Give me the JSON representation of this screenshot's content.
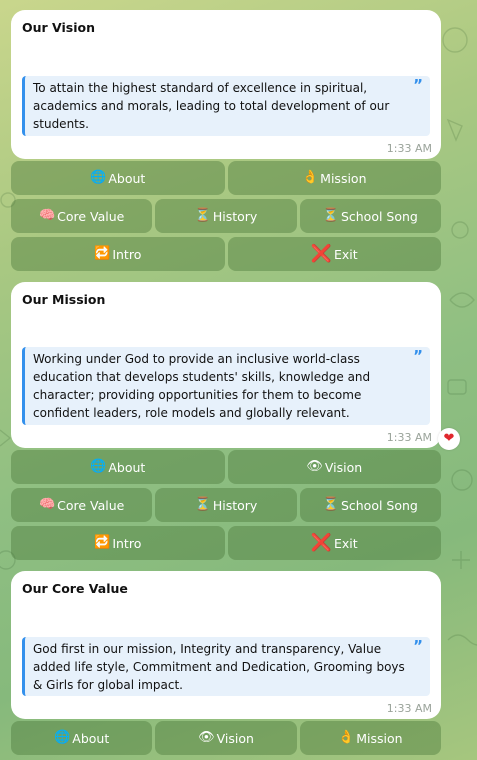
{
  "messages": [
    {
      "title": "Our Vision",
      "quote": "To attain the highest standard of excellence in spiritual, academics and morals, leading to total development of our students.",
      "time": "1:33 AM",
      "reaction": null
    },
    {
      "title": "Our Mission",
      "quote": "Working under God to provide an inclusive world-class education that develops students' skills, knowledge and character; providing opportunities for them to become confident leaders, role models and globally relevant.",
      "time": "1:33 AM",
      "reaction": "heart"
    },
    {
      "title": "Our Core Value",
      "quote": "God first in our mission, Integrity and transparency, Value added life style, Commitment and Dedication, Grooming boys & Girls for global impact.",
      "time": "1:33 AM",
      "reaction": null
    }
  ],
  "quote_mark": "”",
  "reaction_glyph": "❤",
  "keyboards": [
    [
      [
        {
          "icon": "🌐",
          "label": "About"
        },
        {
          "icon": "👌",
          "label": "Mission"
        }
      ],
      [
        {
          "icon": "🧠",
          "label": "Core Value"
        },
        {
          "icon": "⏳",
          "label": "History"
        },
        {
          "icon": "⏳",
          "label": "School Song"
        }
      ],
      [
        {
          "icon": "🔁",
          "label": "Intro"
        },
        {
          "icon": "❌",
          "label": "Exit"
        }
      ]
    ],
    [
      [
        {
          "icon": "🌐",
          "label": "About"
        },
        {
          "icon": "👁",
          "label": "Vision"
        }
      ],
      [
        {
          "icon": "🧠",
          "label": "Core Value"
        },
        {
          "icon": "⏳",
          "label": "History"
        },
        {
          "icon": "⏳",
          "label": "School Song"
        }
      ],
      [
        {
          "icon": "🔁",
          "label": "Intro"
        },
        {
          "icon": "❌",
          "label": "Exit"
        }
      ]
    ],
    [
      [
        {
          "icon": "🌐",
          "label": "About"
        },
        {
          "icon": "👁",
          "label": "Vision"
        },
        {
          "icon": "👌",
          "label": "Mission"
        }
      ]
    ]
  ],
  "colors": {
    "bubble": "#ffffff",
    "quote_bg": "#e7f1fb",
    "quote_bar": "#3390ec",
    "button_bg": "rgba(74,118,58,0.42)",
    "reaction_heart": "#e0282e"
  }
}
